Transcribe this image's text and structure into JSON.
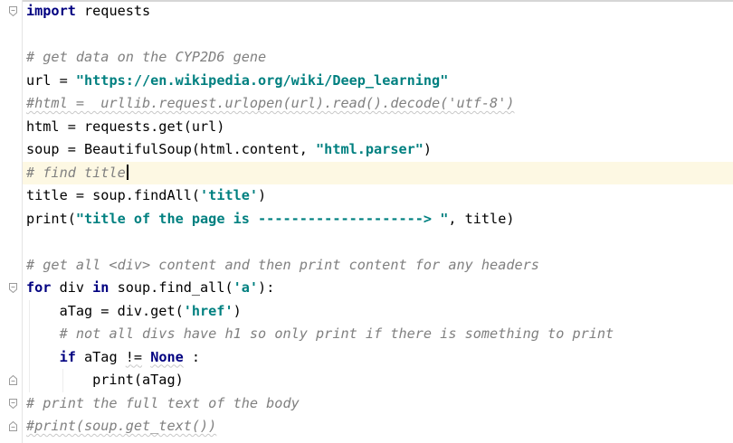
{
  "editor": {
    "lines": [
      {
        "segments": [
          {
            "t": "import",
            "c": "kw"
          },
          {
            "t": " requests",
            "c": ""
          }
        ]
      },
      {
        "segments": []
      },
      {
        "segments": [
          {
            "t": "# get data on the CYP2D6 gene",
            "c": "cmt"
          }
        ]
      },
      {
        "segments": [
          {
            "t": "url = ",
            "c": ""
          },
          {
            "t": "\"https://en.wikipedia.org/wiki/Deep_learning\"",
            "c": "str"
          }
        ]
      },
      {
        "segments": [
          {
            "t": "#html =  urllib.request.urlopen(url).read().decode('utf-8')",
            "c": "cmt squiggle"
          }
        ]
      },
      {
        "segments": [
          {
            "t": "html = requests.get(url)",
            "c": ""
          }
        ]
      },
      {
        "segments": [
          {
            "t": "soup = BeautifulSoup(html.content, ",
            "c": ""
          },
          {
            "t": "\"html.parser\"",
            "c": "str"
          },
          {
            "t": ")",
            "c": ""
          }
        ]
      },
      {
        "segments": [
          {
            "t": "# find title",
            "c": "cmt"
          }
        ],
        "current": true,
        "caret": true
      },
      {
        "segments": [
          {
            "t": "title = soup.findAll(",
            "c": ""
          },
          {
            "t": "'title'",
            "c": "str"
          },
          {
            "t": ")",
            "c": ""
          }
        ]
      },
      {
        "segments": [
          {
            "t": "print(",
            "c": ""
          },
          {
            "t": "\"title of the page is --------------------> \"",
            "c": "str"
          },
          {
            "t": ", title)",
            "c": ""
          }
        ]
      },
      {
        "segments": []
      },
      {
        "segments": [
          {
            "t": "# get all <div> content and then print content for any headers",
            "c": "cmt"
          }
        ]
      },
      {
        "segments": [
          {
            "t": "for",
            "c": "kw"
          },
          {
            "t": " div ",
            "c": ""
          },
          {
            "t": "in",
            "c": "kw"
          },
          {
            "t": " soup.find_all(",
            "c": ""
          },
          {
            "t": "'a'",
            "c": "str"
          },
          {
            "t": "):",
            "c": ""
          }
        ]
      },
      {
        "segments": [
          {
            "t": "    aTag = div.get(",
            "c": ""
          },
          {
            "t": "'href'",
            "c": "str"
          },
          {
            "t": ")",
            "c": ""
          }
        ]
      },
      {
        "segments": [
          {
            "t": "    ",
            "c": ""
          },
          {
            "t": "# not all divs have h1 so only print if there is something to print",
            "c": "cmt"
          }
        ]
      },
      {
        "segments": [
          {
            "t": "    ",
            "c": ""
          },
          {
            "t": "if",
            "c": "kw"
          },
          {
            "t": " aTag ",
            "c": ""
          },
          {
            "t": "!=",
            "c": "squiggle"
          },
          {
            "t": " ",
            "c": ""
          },
          {
            "t": "None",
            "c": "kw squiggle"
          },
          {
            "t": " :",
            "c": ""
          }
        ]
      },
      {
        "segments": [
          {
            "t": "        print(aTag)",
            "c": ""
          }
        ]
      },
      {
        "segments": [
          {
            "t": "# print the full text of the body",
            "c": "cmt"
          }
        ]
      },
      {
        "segments": [
          {
            "t": "#print(soup.get_text())",
            "c": "cmt squiggle"
          }
        ]
      }
    ]
  },
  "fold_markers": [
    {
      "line": 0,
      "icon": "fold-start-icon"
    },
    {
      "line": 12,
      "icon": "fold-start-icon"
    },
    {
      "line": 16,
      "icon": "fold-end-icon"
    },
    {
      "line": 17,
      "icon": "fold-start-icon"
    },
    {
      "line": 18,
      "icon": "fold-end-icon"
    }
  ],
  "colors": {
    "keyword": "#000080",
    "string": "#008080",
    "comment": "#808080",
    "current_line": "#fdf8e3",
    "background": "#ffffff"
  }
}
